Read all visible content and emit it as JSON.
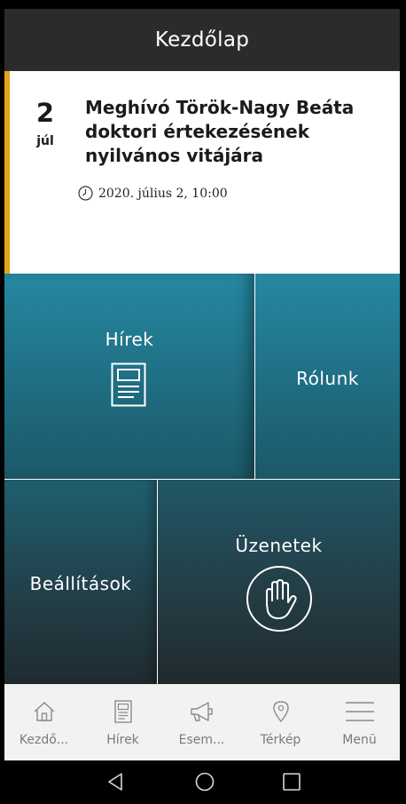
{
  "header": {
    "title": "Kezdőlap"
  },
  "event": {
    "day": "2",
    "month": "júl",
    "title": "Meghívó Török-Nagy Beáta doktori értekezésének nyilvános vitájára",
    "datetime": "2020. július 2, 10:00",
    "icon": "clock-icon"
  },
  "tiles": {
    "news": {
      "label": "Hírek",
      "icon": "document-icon"
    },
    "about": {
      "label": "Rólunk"
    },
    "settings": {
      "label": "Beállítások"
    },
    "messages": {
      "label": "Üzenetek",
      "icon": "hand-icon"
    }
  },
  "tabbar": {
    "items": [
      {
        "label": "Kezdő...",
        "icon": "home-icon"
      },
      {
        "label": "Hírek",
        "icon": "news-icon"
      },
      {
        "label": "Esem...",
        "icon": "megaphone-icon"
      },
      {
        "label": "Térkép",
        "icon": "map-pin-icon"
      },
      {
        "label": "Menü",
        "icon": "menu-icon"
      }
    ]
  },
  "colors": {
    "header": "#2c2b29",
    "accent": "#e0a31c",
    "tile_top": "#2688a1",
    "tile_dark": "#212a2e"
  }
}
